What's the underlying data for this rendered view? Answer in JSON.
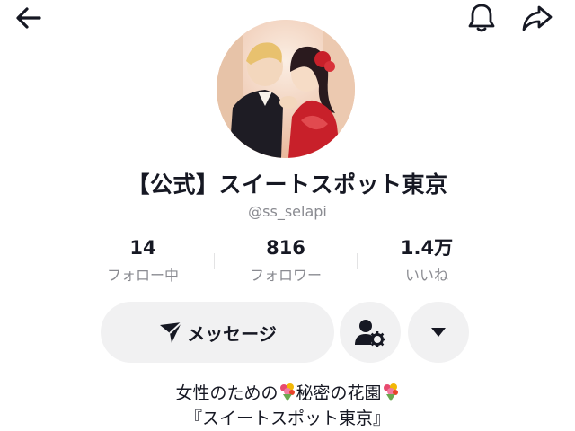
{
  "header": {
    "back_icon": "arrow-left-icon",
    "notification_icon": "bell-icon",
    "share_icon": "share-arrow-icon"
  },
  "profile": {
    "avatar": "profile-avatar-illustration",
    "display_name": "【公式】スイートスポット東京",
    "username": "@ss_selapi"
  },
  "stats": [
    {
      "value": "14",
      "label": "フォロー中"
    },
    {
      "value": "816",
      "label": "フォロワー"
    },
    {
      "value": "1.4万",
      "label": "いいね"
    }
  ],
  "actions": {
    "message_label": "メッセージ",
    "message_icon": "send-icon",
    "suggest_icon": "user-settings-icon",
    "more_icon": "caret-down-icon"
  },
  "bio": {
    "line1_part1": "女性のための",
    "line1_part2": "秘密の花園",
    "line2": "『スイートスポット東京』",
    "emoji_icon": "bouquet-icon"
  }
}
